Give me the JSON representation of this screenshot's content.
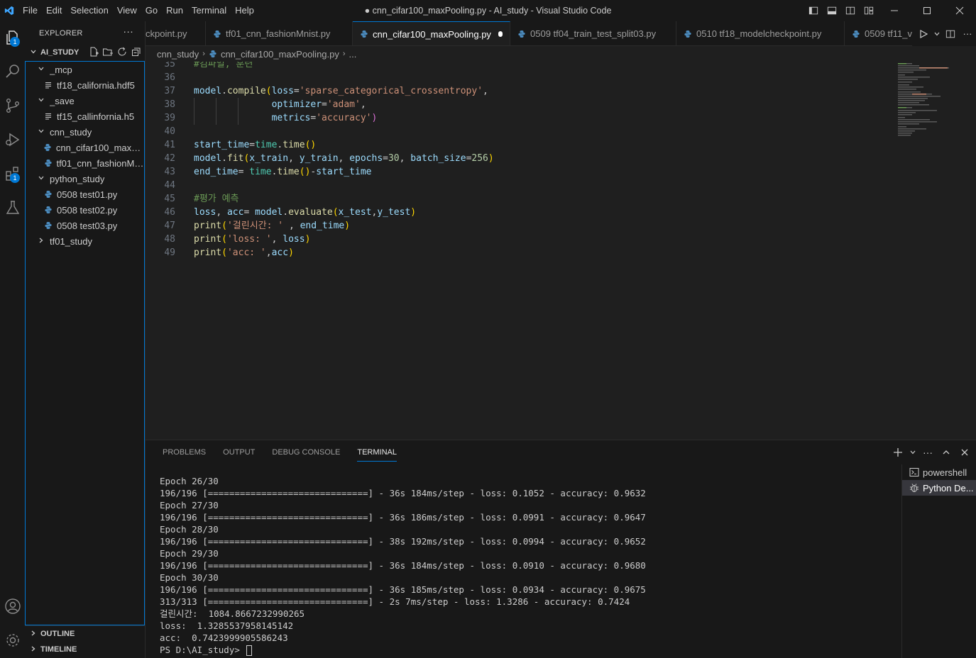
{
  "titlebar": {
    "menu": [
      "File",
      "Edit",
      "Selection",
      "View",
      "Go",
      "Run",
      "Terminal",
      "Help"
    ],
    "title": "● cnn_cifar100_maxPooling.py - AI_study - Visual Studio Code"
  },
  "activity": {
    "explorer_badge": "1",
    "extensions_badge": "1"
  },
  "sidebar": {
    "header": "EXPLORER",
    "more": "···",
    "workspace": "AI_STUDY",
    "tree": [
      {
        "label": "_mcp",
        "kind": "folder",
        "open": true,
        "depth": 1
      },
      {
        "label": "tf18_california.hdf5",
        "kind": "file",
        "depth": 2
      },
      {
        "label": "_save",
        "kind": "folder",
        "open": true,
        "depth": 1
      },
      {
        "label": "tf15_callinfornia.h5",
        "kind": "file",
        "depth": 2
      },
      {
        "label": "cnn_study",
        "kind": "folder",
        "open": true,
        "depth": 1
      },
      {
        "label": "cnn_cifar100_maxPo...",
        "kind": "py",
        "depth": 2
      },
      {
        "label": "tf01_cnn_fashionMn...",
        "kind": "py",
        "depth": 2
      },
      {
        "label": "python_study",
        "kind": "folder",
        "open": true,
        "depth": 1
      },
      {
        "label": "0508 test01.py",
        "kind": "py",
        "depth": 2
      },
      {
        "label": "0508 test02.py",
        "kind": "py",
        "depth": 2
      },
      {
        "label": "0508 test03.py",
        "kind": "py",
        "depth": 2
      },
      {
        "label": "tf01_study",
        "kind": "folder",
        "open": false,
        "depth": 1
      }
    ],
    "outline": "OUTLINE",
    "timeline": "TIMELINE"
  },
  "tabs": [
    {
      "label": "ckpoint.py",
      "active": false,
      "icon": false
    },
    {
      "label": "tf01_cnn_fashionMnist.py",
      "active": false,
      "icon": true
    },
    {
      "label": "cnn_cifar100_maxPooling.py",
      "active": true,
      "icon": true,
      "dirty": true
    },
    {
      "label": "0509 tf04_train_test_split03.py",
      "active": false,
      "icon": true
    },
    {
      "label": "0510 tf18_modelcheckpoint.py",
      "active": false,
      "icon": true
    },
    {
      "label": "0509 tf11_v",
      "active": false,
      "icon": true
    }
  ],
  "breadcrumb": [
    "cnn_study",
    "cnn_cifar100_maxPooling.py",
    "..."
  ],
  "editor": {
    "lines": [
      {
        "n": "35",
        "text": "#컴파일, 훈련"
      },
      {
        "n": "36",
        "text": ""
      },
      {
        "n": "37",
        "text": "model.compile(loss='sparse_categorical_crossentropy',"
      },
      {
        "n": "38",
        "text": "              optimizer='adam',"
      },
      {
        "n": "39",
        "text": "              metrics='accuracy')"
      },
      {
        "n": "40",
        "text": ""
      },
      {
        "n": "41",
        "text": "start_time=time.time()"
      },
      {
        "n": "42",
        "text": "model.fit(x_train, y_train, epochs=30, batch_size=256)"
      },
      {
        "n": "43",
        "text": "end_time= time.time()-start_time"
      },
      {
        "n": "44",
        "text": ""
      },
      {
        "n": "45",
        "text": "#평가 예측"
      },
      {
        "n": "46",
        "text": "loss, acc= model.evaluate(x_test,y_test)"
      },
      {
        "n": "47",
        "text": "print('걸린시간: ' , end_time)"
      },
      {
        "n": "48",
        "text": "print('loss: ', loss)"
      },
      {
        "n": "49",
        "text": "print('acc: ',acc)"
      }
    ]
  },
  "panel": {
    "tabs": [
      "PROBLEMS",
      "OUTPUT",
      "DEBUG CONSOLE",
      "TERMINAL"
    ],
    "active_tab": "TERMINAL",
    "terminal_lines": [
      "Epoch 26/30",
      "196/196 [==============================] - 36s 184ms/step - loss: 0.1052 - accuracy: 0.9632",
      "Epoch 27/30",
      "196/196 [==============================] - 36s 186ms/step - loss: 0.0991 - accuracy: 0.9647",
      "Epoch 28/30",
      "196/196 [==============================] - 38s 192ms/step - loss: 0.0994 - accuracy: 0.9652",
      "Epoch 29/30",
      "196/196 [==============================] - 36s 184ms/step - loss: 0.0910 - accuracy: 0.9680",
      "Epoch 30/30",
      "196/196 [==============================] - 36s 185ms/step - loss: 0.0934 - accuracy: 0.9675",
      "313/313 [==============================] - 2s 7ms/step - loss: 1.3286 - accuracy: 0.7424",
      "걸린시간:  1084.8667232990265",
      "loss:  1.3285537958145142",
      "acc:  0.7423999905586243"
    ],
    "prompt": "PS D:\\AI_study> ",
    "terminals": [
      {
        "label": "powershell",
        "active": false
      },
      {
        "label": "Python De...",
        "active": true
      }
    ]
  },
  "colors": {
    "accent": "#0078d4",
    "python_icon": "#4b8bbe"
  }
}
